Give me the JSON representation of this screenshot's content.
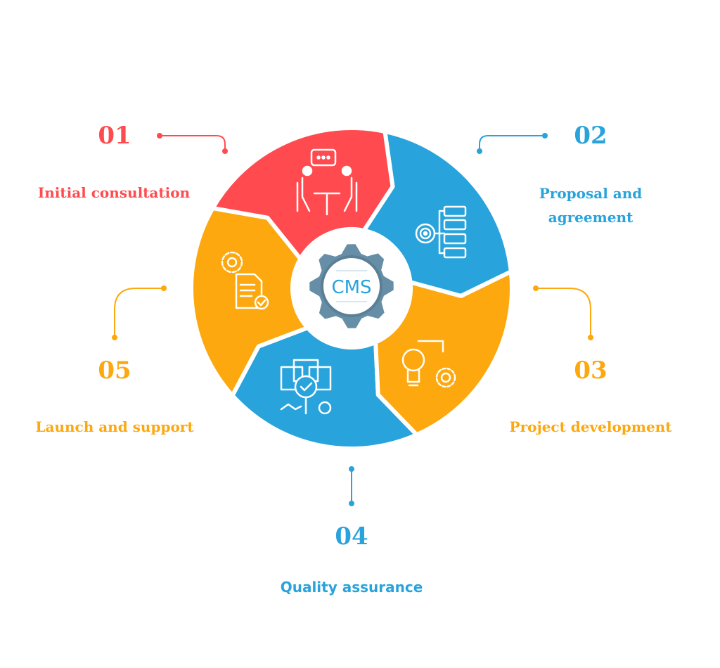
{
  "center": {
    "label": "CMS",
    "gear_color": "#668EA6",
    "text_color": "#29A3DB"
  },
  "colors": {
    "red": "#FF4B4F",
    "blue": "#29A3DB",
    "orange": "#FCA80E"
  },
  "steps": [
    {
      "number": "01",
      "title": "Initial consultation",
      "color": "#FF4B4F",
      "icon": "meeting-icon"
    },
    {
      "number": "02",
      "title_line1": "Proposal and",
      "title_line2": "agreement",
      "color": "#29A3DB",
      "icon": "checklist-target-icon"
    },
    {
      "number": "03",
      "title": "Project development",
      "color": "#FCA80E",
      "icon": "lightbulb-gear-icon"
    },
    {
      "number": "04",
      "title": "Quality assurance",
      "color": "#29A3DB",
      "icon": "document-inspection-icon"
    },
    {
      "number": "05",
      "title": "Launch and support",
      "color": "#FCA80E",
      "icon": "gear-document-icon"
    }
  ]
}
